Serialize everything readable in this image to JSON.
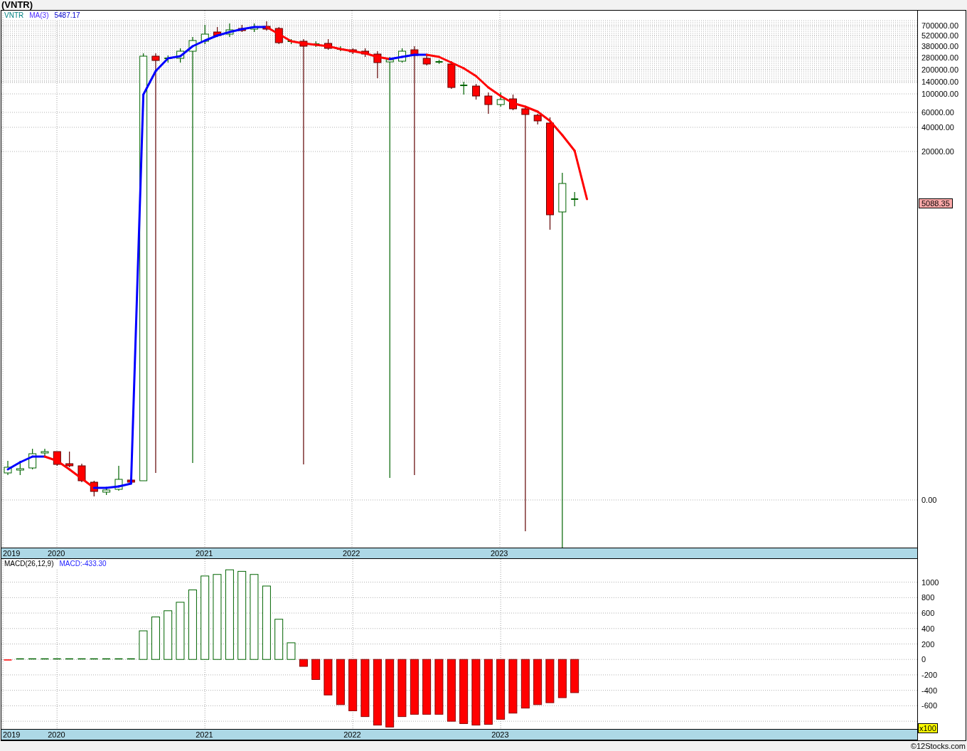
{
  "title": "(VNTR)",
  "price_panel": {
    "legend": {
      "symbol": "VNTR",
      "indicator": "MA(3)",
      "value": "5487.17"
    },
    "axis_labels": [
      "700000.00",
      "520000.00",
      "380000.00",
      "280000.00",
      "200000.00",
      "140000.00",
      "100000.00",
      "60000.00",
      "40000.00",
      "20000.00",
      "0.00"
    ],
    "last_price": "5088.35",
    "date_labels": [
      "2019",
      "2020",
      "2021",
      "2022",
      "2023"
    ]
  },
  "macd_panel": {
    "label": "MACD(26,12,9)",
    "reading": "MACD:-433.30",
    "scale_badge": "x100",
    "chart_data": {
      "type": "bar",
      "x": [
        2019.667,
        2019.75,
        2019.833,
        2019.917,
        2020.0,
        2020.083,
        2020.167,
        2020.25,
        2020.333,
        2020.417,
        2020.5,
        2020.583,
        2020.667,
        2020.75,
        2020.833,
        2020.917,
        2021.0,
        2021.083,
        2021.167,
        2021.25,
        2021.333,
        2021.417,
        2021.5,
        2021.583,
        2021.667,
        2021.75,
        2021.833,
        2021.917,
        2022.0,
        2022.083,
        2022.167,
        2022.25,
        2022.333,
        2022.417,
        2022.5,
        2022.583,
        2022.667,
        2022.75,
        2022.833,
        2022.917,
        2023.0,
        2023.083,
        2023.167,
        2023.25,
        2023.333,
        2023.417,
        2023.5
      ],
      "values": [
        -2,
        2,
        2,
        2,
        2,
        2,
        2,
        2,
        2,
        2,
        2,
        370,
        550,
        630,
        740,
        900,
        1080,
        1100,
        1160,
        1140,
        1100,
        950,
        520,
        215,
        -90,
        -260,
        -460,
        -585,
        -665,
        -740,
        -850,
        -875,
        -740,
        -710,
        -710,
        -710,
        -800,
        -830,
        -850,
        -840,
        -775,
        -695,
        -630,
        -585,
        -560,
        -495,
        -430
      ],
      "xlim": [
        2019.624,
        2025.817
      ],
      "ylim": [
        -900,
        1300
      ],
      "grid": true,
      "xticks": [
        {
          "value": 2020,
          "label": "2020"
        },
        {
          "value": 2021,
          "label": "2021"
        },
        {
          "value": 2022,
          "label": "2022"
        },
        {
          "value": 2023,
          "label": "2023"
        }
      ],
      "yticks": [
        {
          "value": 1000,
          "label": "1000"
        },
        {
          "value": 800,
          "label": "800"
        },
        {
          "value": 600,
          "label": "600"
        },
        {
          "value": 400,
          "label": "400"
        },
        {
          "value": 200,
          "label": "200"
        },
        {
          "value": 0,
          "label": "0"
        },
        {
          "value": -200,
          "label": "-200"
        },
        {
          "value": -400,
          "label": "-400"
        },
        {
          "value": -600,
          "label": "-600"
        }
      ]
    },
    "axis_start_label": "2019"
  },
  "footer": "©12Stocks.com"
}
